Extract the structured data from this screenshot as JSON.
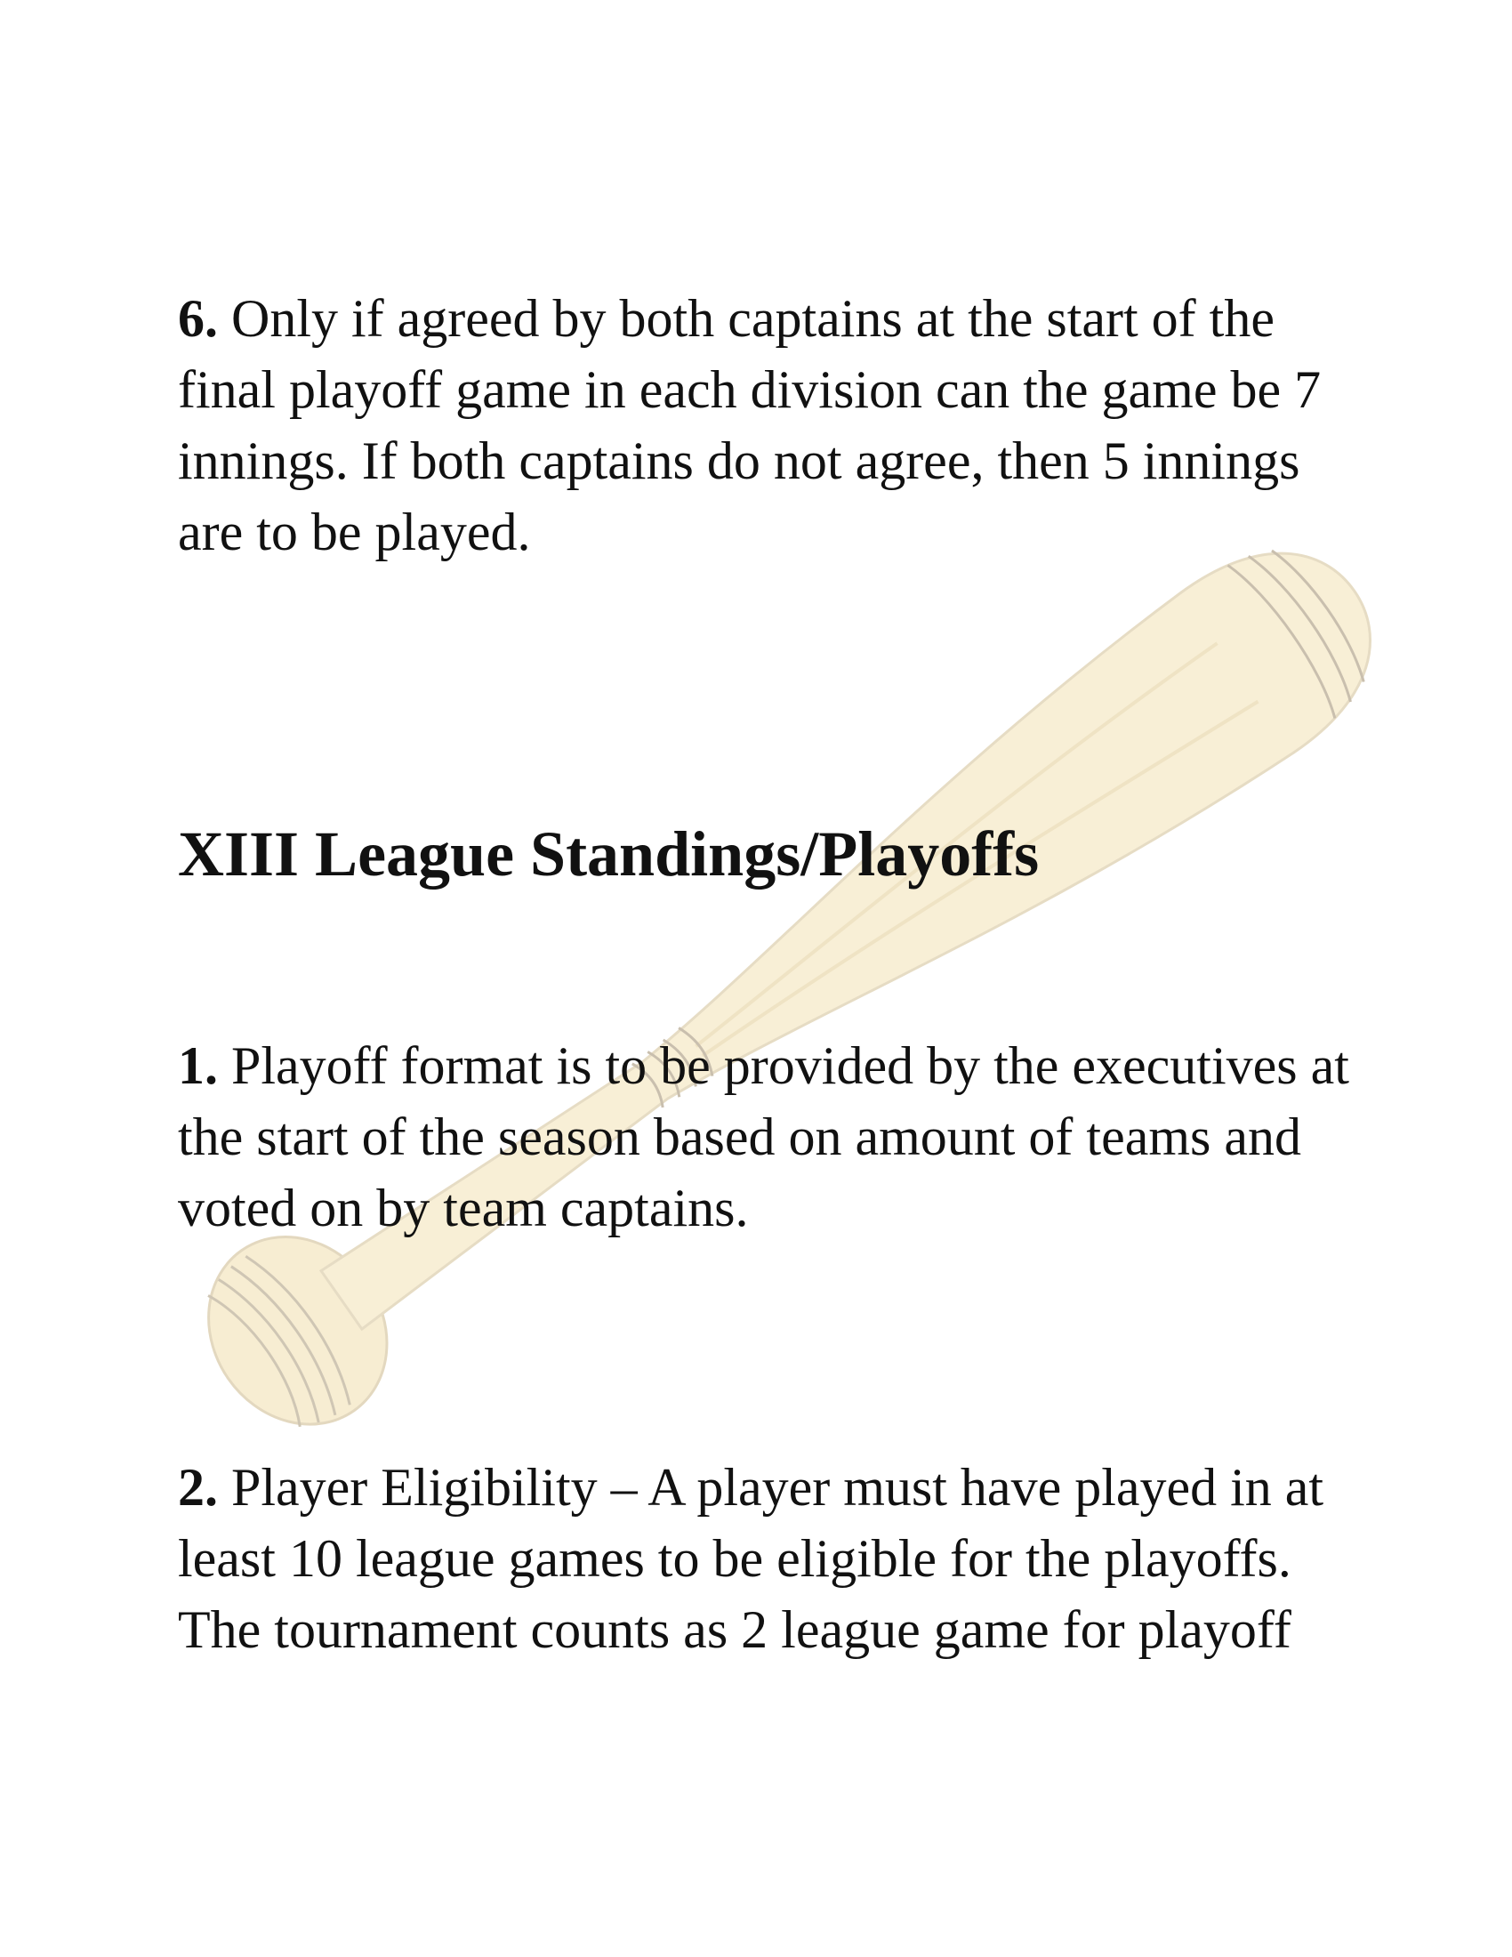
{
  "document": {
    "rule6": {
      "number": "6.",
      "text": " Only if agreed by both captains at the start of the final playoff game in each division can the game be 7 innings.  If both captains do not agree, then 5 innings are to be played."
    },
    "section_heading": "XIII League Standings/Playoffs",
    "rule1": {
      "number": "1.",
      "text": "  Playoff format is to be provided by the executives at the start of the season based on amount of teams and voted on by team captains."
    },
    "rule2": {
      "number": "2.",
      "text": " Player Eligibility – A player must have played in at least 10 league games to be eligible for the playoffs.  The tournament counts as 2 league game for playoff"
    }
  },
  "watermark": {
    "icon": "baseball-bat-icon",
    "fill_color": "#f7edd2",
    "stripe_color": "#c9bfae"
  }
}
